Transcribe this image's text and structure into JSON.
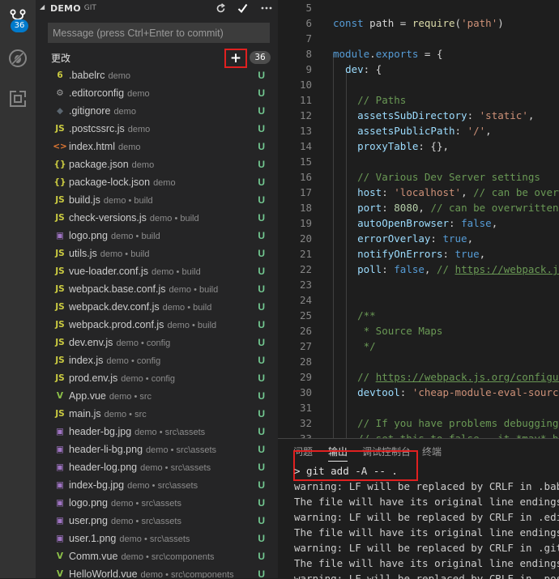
{
  "activity_bar": {
    "scm_badge": "36",
    "icons": [
      "source-control-icon",
      "debug-icon",
      "extensions-icon"
    ]
  },
  "sidebar": {
    "title": "DEMO",
    "subtitle": "GIT",
    "commit_placeholder": "Message (press Ctrl+Enter to commit)",
    "changes_label": "更改",
    "changes_count": "36",
    "plus_label": "+",
    "files": [
      {
        "icon": "6",
        "color": "#cbcb41",
        "name": ".babelrc",
        "path": "demo",
        "status": "U"
      },
      {
        "icon": "⚙",
        "color": "#a0a0a0",
        "name": ".editorconfig",
        "path": "demo",
        "status": "U"
      },
      {
        "icon": "◆",
        "color": "#5b6670",
        "name": ".gitignore",
        "path": "demo",
        "status": "U"
      },
      {
        "icon": "JS",
        "color": "#cbcb41",
        "name": ".postcssrc.js",
        "path": "demo",
        "status": "U"
      },
      {
        "icon": "<>",
        "color": "#e37933",
        "name": "index.html",
        "path": "demo",
        "status": "U"
      },
      {
        "icon": "{}",
        "color": "#cbcb41",
        "name": "package.json",
        "path": "demo",
        "status": "U"
      },
      {
        "icon": "{}",
        "color": "#cbcb41",
        "name": "package-lock.json",
        "path": "demo",
        "status": "U"
      },
      {
        "icon": "JS",
        "color": "#cbcb41",
        "name": "build.js",
        "path": "demo • build",
        "status": "U"
      },
      {
        "icon": "JS",
        "color": "#cbcb41",
        "name": "check-versions.js",
        "path": "demo • build",
        "status": "U"
      },
      {
        "icon": "▣",
        "color": "#a074c4",
        "name": "logo.png",
        "path": "demo • build",
        "status": "U"
      },
      {
        "icon": "JS",
        "color": "#cbcb41",
        "name": "utils.js",
        "path": "demo • build",
        "status": "U"
      },
      {
        "icon": "JS",
        "color": "#cbcb41",
        "name": "vue-loader.conf.js",
        "path": "demo • build",
        "status": "U"
      },
      {
        "icon": "JS",
        "color": "#cbcb41",
        "name": "webpack.base.conf.js",
        "path": "demo • build",
        "status": "U"
      },
      {
        "icon": "JS",
        "color": "#cbcb41",
        "name": "webpack.dev.conf.js",
        "path": "demo • build",
        "status": "U"
      },
      {
        "icon": "JS",
        "color": "#cbcb41",
        "name": "webpack.prod.conf.js",
        "path": "demo • build",
        "status": "U"
      },
      {
        "icon": "JS",
        "color": "#cbcb41",
        "name": "dev.env.js",
        "path": "demo • config",
        "status": "U"
      },
      {
        "icon": "JS",
        "color": "#cbcb41",
        "name": "index.js",
        "path": "demo • config",
        "status": "U"
      },
      {
        "icon": "JS",
        "color": "#cbcb41",
        "name": "prod.env.js",
        "path": "demo • config",
        "status": "U"
      },
      {
        "icon": "V",
        "color": "#8dc149",
        "name": "App.vue",
        "path": "demo • src",
        "status": "U"
      },
      {
        "icon": "JS",
        "color": "#cbcb41",
        "name": "main.js",
        "path": "demo • src",
        "status": "U"
      },
      {
        "icon": "▣",
        "color": "#a074c4",
        "name": "header-bg.jpg",
        "path": "demo • src\\assets",
        "status": "U"
      },
      {
        "icon": "▣",
        "color": "#a074c4",
        "name": "header-li-bg.png",
        "path": "demo • src\\assets",
        "status": "U"
      },
      {
        "icon": "▣",
        "color": "#a074c4",
        "name": "header-log.png",
        "path": "demo • src\\assets",
        "status": "U"
      },
      {
        "icon": "▣",
        "color": "#a074c4",
        "name": "index-bg.jpg",
        "path": "demo • src\\assets",
        "status": "U"
      },
      {
        "icon": "▣",
        "color": "#a074c4",
        "name": "logo.png",
        "path": "demo • src\\assets",
        "status": "U"
      },
      {
        "icon": "▣",
        "color": "#a074c4",
        "name": "user.png",
        "path": "demo • src\\assets",
        "status": "U"
      },
      {
        "icon": "▣",
        "color": "#a074c4",
        "name": "user.1.png",
        "path": "demo • src\\assets",
        "status": "U"
      },
      {
        "icon": "V",
        "color": "#8dc149",
        "name": "Comm.vue",
        "path": "demo • src\\components",
        "status": "U"
      },
      {
        "icon": "V",
        "color": "#8dc149",
        "name": "HelloWorld.vue",
        "path": "demo • src\\components",
        "status": "U"
      }
    ]
  },
  "editor": {
    "lines": [
      {
        "n": "5",
        "t": []
      },
      {
        "n": "6",
        "t": [
          [
            "t-kw",
            "const"
          ],
          [
            "t-pl",
            " path = "
          ],
          [
            "t-fn",
            "require"
          ],
          [
            "t-pl",
            "("
          ],
          [
            "t-str",
            "'path'"
          ],
          [
            "t-pl",
            ")"
          ]
        ]
      },
      {
        "n": "7",
        "t": []
      },
      {
        "n": "8",
        "t": [
          [
            "t-kw",
            "module"
          ],
          [
            "t-pl",
            "."
          ],
          [
            "t-kw",
            "exports"
          ],
          [
            "t-pl",
            " = {"
          ]
        ]
      },
      {
        "n": "9",
        "t": [
          [
            "t-pl",
            "  "
          ],
          [
            "t-prop",
            "dev"
          ],
          [
            "t-pl",
            ": {"
          ]
        ]
      },
      {
        "n": "10",
        "t": []
      },
      {
        "n": "11",
        "t": [
          [
            "t-cmt",
            "    // Paths"
          ]
        ]
      },
      {
        "n": "12",
        "t": [
          [
            "t-pl",
            "    "
          ],
          [
            "t-prop",
            "assetsSubDirectory"
          ],
          [
            "t-pl",
            ": "
          ],
          [
            "t-str",
            "'static'"
          ],
          [
            "t-pl",
            ","
          ]
        ]
      },
      {
        "n": "13",
        "t": [
          [
            "t-pl",
            "    "
          ],
          [
            "t-prop",
            "assetsPublicPath"
          ],
          [
            "t-pl",
            ": "
          ],
          [
            "t-str",
            "'/'"
          ],
          [
            "t-pl",
            ","
          ]
        ]
      },
      {
        "n": "14",
        "t": [
          [
            "t-pl",
            "    "
          ],
          [
            "t-prop",
            "proxyTable"
          ],
          [
            "t-pl",
            ": {},"
          ]
        ]
      },
      {
        "n": "15",
        "t": []
      },
      {
        "n": "16",
        "t": [
          [
            "t-cmt",
            "    // Various Dev Server settings"
          ]
        ]
      },
      {
        "n": "17",
        "t": [
          [
            "t-pl",
            "    "
          ],
          [
            "t-prop",
            "host"
          ],
          [
            "t-pl",
            ": "
          ],
          [
            "t-str",
            "'localhost'"
          ],
          [
            "t-pl",
            ", "
          ],
          [
            "t-cmt",
            "// can be overwritten by process.env.HOST"
          ]
        ]
      },
      {
        "n": "18",
        "t": [
          [
            "t-pl",
            "    "
          ],
          [
            "t-prop",
            "port"
          ],
          [
            "t-pl",
            ": "
          ],
          [
            "t-num",
            "8080"
          ],
          [
            "t-pl",
            ", "
          ],
          [
            "t-cmt",
            "// can be overwritten by process.env.PORT"
          ]
        ]
      },
      {
        "n": "19",
        "t": [
          [
            "t-pl",
            "    "
          ],
          [
            "t-prop",
            "autoOpenBrowser"
          ],
          [
            "t-pl",
            ": "
          ],
          [
            "t-kw",
            "false"
          ],
          [
            "t-pl",
            ","
          ]
        ]
      },
      {
        "n": "20",
        "t": [
          [
            "t-pl",
            "    "
          ],
          [
            "t-prop",
            "errorOverlay"
          ],
          [
            "t-pl",
            ": "
          ],
          [
            "t-kw",
            "true"
          ],
          [
            "t-pl",
            ","
          ]
        ]
      },
      {
        "n": "21",
        "t": [
          [
            "t-pl",
            "    "
          ],
          [
            "t-prop",
            "notifyOnErrors"
          ],
          [
            "t-pl",
            ": "
          ],
          [
            "t-kw",
            "true"
          ],
          [
            "t-pl",
            ","
          ]
        ]
      },
      {
        "n": "22",
        "t": [
          [
            "t-pl",
            "    "
          ],
          [
            "t-prop",
            "poll"
          ],
          [
            "t-pl",
            ": "
          ],
          [
            "t-kw",
            "false"
          ],
          [
            "t-pl",
            ", "
          ],
          [
            "t-cmt",
            "// "
          ],
          [
            "t-url",
            "https://webpack.js.org/configuration/dev-server/"
          ]
        ]
      },
      {
        "n": "23",
        "t": []
      },
      {
        "n": "24",
        "t": []
      },
      {
        "n": "25",
        "t": [
          [
            "t-cmt",
            "    /**"
          ]
        ]
      },
      {
        "n": "26",
        "t": [
          [
            "t-cmt",
            "     * Source Maps"
          ]
        ]
      },
      {
        "n": "27",
        "t": [
          [
            "t-cmt",
            "     */"
          ]
        ]
      },
      {
        "n": "28",
        "t": []
      },
      {
        "n": "29",
        "t": [
          [
            "t-cmt",
            "    // "
          ],
          [
            "t-url",
            "https://webpack.js.org/configuration/devtool/"
          ]
        ]
      },
      {
        "n": "30",
        "t": [
          [
            "t-pl",
            "    "
          ],
          [
            "t-prop",
            "devtool"
          ],
          [
            "t-pl",
            ": "
          ],
          [
            "t-str",
            "'cheap-module-eval-source-map'"
          ],
          [
            "t-pl",
            ","
          ]
        ]
      },
      {
        "n": "31",
        "t": []
      },
      {
        "n": "32",
        "t": [
          [
            "t-cmt",
            "    // If you have problems debugging vue-files in devtools,"
          ]
        ]
      },
      {
        "n": "33",
        "t": [
          [
            "t-cmt",
            "    // set this to false - it *may* help"
          ]
        ]
      }
    ]
  },
  "panel": {
    "tabs": [
      "问题",
      "输出",
      "调试控制台",
      "终端"
    ],
    "command": "> git add -A -- .",
    "output": [
      "warning: LF will be replaced by CRLF in .babelrc.",
      "The file will have its original line endings in your working directory.",
      "warning: LF will be replaced by CRLF in .editorconfig.",
      "The file will have its original line endings in your working directory.",
      "warning: LF will be replaced by CRLF in .gitignore.",
      "The file will have its original line endings in your working directory.",
      "warning: LF will be replaced by CRLF in .postcssrc.js."
    ]
  }
}
